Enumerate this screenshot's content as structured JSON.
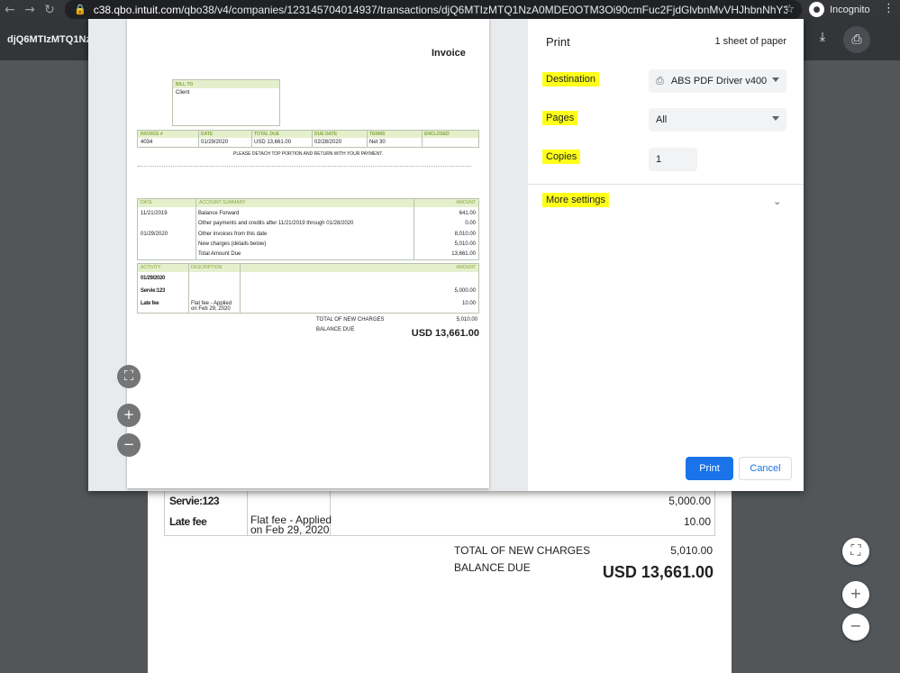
{
  "browser": {
    "url_host": "c38.qbo.intuit.com",
    "url_path": "/qbo38/v4/companies/123145704014937/transactions/djQ6MTIzMTQ1NzA0MDE0OTM3Oi90cmFuc2FjdGlvbnMvVHJhbnNhY3Rpb24...",
    "incognito_label": "Incognito",
    "icons": [
      "back-icon",
      "forward-icon",
      "reload-icon",
      "lock-icon",
      "star-icon",
      "incognito-icon",
      "kebab-menu-icon"
    ]
  },
  "pdf_viewer": {
    "title": "djQ6MTIzMTQ1Nz",
    "icons": [
      "download-icon",
      "print-icon",
      "fit-page-icon",
      "zoom-in-icon",
      "zoom-out-icon"
    ]
  },
  "background_doc": {
    "row1": {
      "activity": "Servie:123",
      "description": "",
      "amount": "5,000.00"
    },
    "row2": {
      "activity": "Late fee",
      "description_line1": "Flat fee - Applied",
      "description_line2": "on Feb 29, 2020",
      "amount": "10.00"
    },
    "total_new_charges_label": "TOTAL OF NEW CHARGES",
    "total_new_charges": "5,010.00",
    "balance_due_label": "BALANCE DUE",
    "balance_due": "USD 13,661.00"
  },
  "preview": {
    "title": "Invoice",
    "bill_to_label": "BILL TO",
    "bill_to_value": "Client",
    "summary_headers": [
      "INVOICE #",
      "DATE",
      "TOTAL DUE",
      "DUE DATE",
      "TERMS",
      "ENCLOSED"
    ],
    "summary_values": [
      "4034",
      "01/29/2020",
      "USD 13,661.00",
      "02/28/2020",
      "Net 30",
      ""
    ],
    "detach_note": "PLEASE DETACH TOP PORTION AND RETURN WITH YOUR PAYMENT.",
    "account_headers": {
      "date": "DATE",
      "summary": "ACCOUNT SUMMARY",
      "amount": "AMOUNT"
    },
    "account_rows": [
      {
        "date": "11/21/2019",
        "desc": "Balance Forward",
        "amount": "641.00"
      },
      {
        "date": "",
        "desc": "Other payments and credits after 11/21/2019 through 01/28/2020",
        "amount": "0.00"
      },
      {
        "date": "01/29/2020",
        "desc": "Other invoices from this date",
        "amount": "8,010.00"
      },
      {
        "date": "",
        "desc": "New charges (details below)",
        "amount": "5,010.00"
      },
      {
        "date": "",
        "desc": "Total Amount Due",
        "amount": "13,661.00"
      }
    ],
    "activity_headers": {
      "activity": "ACTIVITY",
      "description": "DESCRIPTION",
      "amount": "AMOUNT"
    },
    "activity_rows": [
      {
        "activity": "01/29/2020",
        "desc1": "",
        "desc2": "",
        "amount": ""
      },
      {
        "activity": "Servie:123",
        "desc1": "",
        "desc2": "",
        "amount": "5,000.00"
      },
      {
        "activity": "Late fee",
        "desc1": "Flat fee - Applied",
        "desc2": "on Feb 29, 2020",
        "amount": "10.00"
      }
    ],
    "total_new_charges_label": "TOTAL OF NEW CHARGES",
    "total_new_charges": "5,010.00",
    "balance_due_label": "BALANCE DUE",
    "balance_due": "USD 13,661.00"
  },
  "print_settings": {
    "title": "Print",
    "sheets": "1 sheet of paper",
    "destination_label": "Destination",
    "destination_value": "ABS PDF Driver v400",
    "pages_label": "Pages",
    "pages_value": "All",
    "copies_label": "Copies",
    "copies_value": "1",
    "more_settings_label": "More settings",
    "print_button": "Print",
    "cancel_button": "Cancel",
    "highlight_color": "#ffff1a",
    "accent_color": "#1a73e8"
  }
}
